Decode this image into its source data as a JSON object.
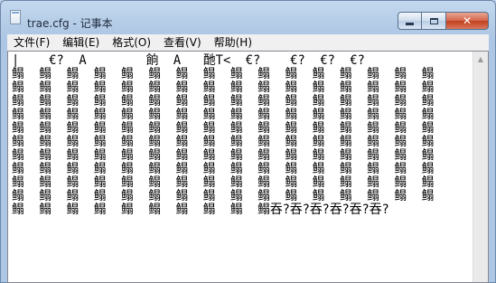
{
  "window": {
    "title": "trae.cfg - 记事本"
  },
  "menu": {
    "items": [
      "文件(F)",
      "编辑(E)",
      "格式(O)",
      "查看(V)",
      "帮助(H)"
    ]
  },
  "editor": {
    "text": "|    €?  A        餉  A   酏T<  €?    €?  €?  €?\n鳎  鳎  鳎  鳎  鳎  鳎  鳎  鳎  鳎  鳎  鳎  鳎  鳎  鳎  鳎  鳎\n鳎  鳎  鳎  鳎  鳎  鳎  鳎  鳎  鳎  鳎  鳎  鳎  鳎  鳎  鳎  鳎\n鳎  鳎  鳎  鳎  鳎  鳎  鳎  鳎  鳎  鳎  鳎  鳎  鳎  鳎  鳎  鳎\n鳎  鳎  鳎  鳎  鳎  鳎  鳎  鳎  鳎  鳎  鳎  鳎  鳎  鳎  鳎  鳎\n鳎  鳎  鳎  鳎  鳎  鳎  鳎  鳎  鳎  鳎  鳎  鳎  鳎  鳎  鳎  鳎\n鳎  鳎  鳎  鳎  鳎  鳎  鳎  鳎  鳎  鳎  鳎  鳎  鳎  鳎  鳎  鳎\n鳎  鳎  鳎  鳎  鳎  鳎  鳎  鳎  鳎  鳎  鳎  鳎  鳎  鳎  鳎  鳎\n鳎  鳎  鳎  鳎  鳎  鳎  鳎  鳎  鳎  鳎  鳎  鳎  鳎  鳎  鳎  鳎\n鳎  鳎  鳎  鳎  鳎  鳎  鳎  鳎  鳎  鳎  鳎  鳎  鳎  鳎  鳎  鳎\n鳎  鳎  鳎  鳎  鳎  鳎  鳎  鳎  鳎  鳎  鳎  鳎  鳎  鳎  鳎  鳎\n鳎  鳎  鳎  鳎  鳎  鳎  鳎  鳎  鳎  鳎吞?吞?吞?吞?吞?吞?"
  },
  "icons": {
    "app": "notepad-icon",
    "minimize": "minimize-icon",
    "maximize": "maximize-icon",
    "close": "close-icon",
    "scroll_up": "scroll-up-arrow-icon"
  },
  "colors": {
    "close_button": "#c94425",
    "title_frame": "#b9d1ea",
    "menu_background": "#f0f0f0",
    "editor_background": "#ffffff"
  }
}
